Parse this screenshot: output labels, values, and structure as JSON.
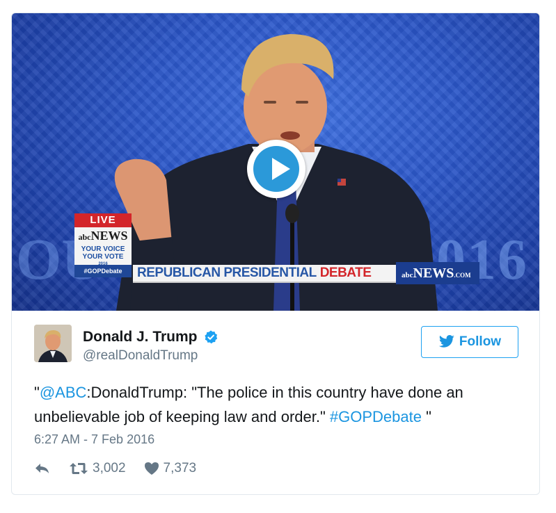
{
  "media": {
    "live_label": "LIVE",
    "network_label": "NEWS",
    "campaign_label_line1": "YOUR VOICE",
    "campaign_label_line2": "YOUR VOTE",
    "campaign_year": "2016",
    "hashtag_tag": "#GOPDebate",
    "banner_blue": "REPUBLICAN PRESIDENTIAL",
    "banner_red": "DEBATE",
    "banner_brand": "NEWS",
    "banner_brand_suffix": ".COM",
    "backdrop_year": "2016",
    "backdrop_left": "OU",
    "play_icon": "play-icon"
  },
  "author": {
    "name": "Donald J. Trump",
    "handle": "@realDonaldTrump",
    "verified_icon": "verified-badge-icon"
  },
  "follow": {
    "label": "Follow",
    "icon": "twitter-bird-icon"
  },
  "tweet": {
    "open_quote": "\"",
    "mention": "@ABC",
    "body": ":DonaldTrump: \"The police in this country have done an unbelievable job of keeping law and order.\" ",
    "hashtag": "#GOPDebate",
    "close": " \"",
    "timestamp": "6:27 AM - 7 Feb 2016"
  },
  "actions": {
    "reply_icon": "reply-icon",
    "retweet_icon": "retweet-icon",
    "retweet_count": "3,002",
    "like_icon": "heart-icon",
    "like_count": "7,373"
  },
  "colors": {
    "link": "#1b95e0",
    "follow_border": "#1da1f2",
    "muted": "#657786",
    "text": "#14171a",
    "play_button": "#2b99d9"
  }
}
